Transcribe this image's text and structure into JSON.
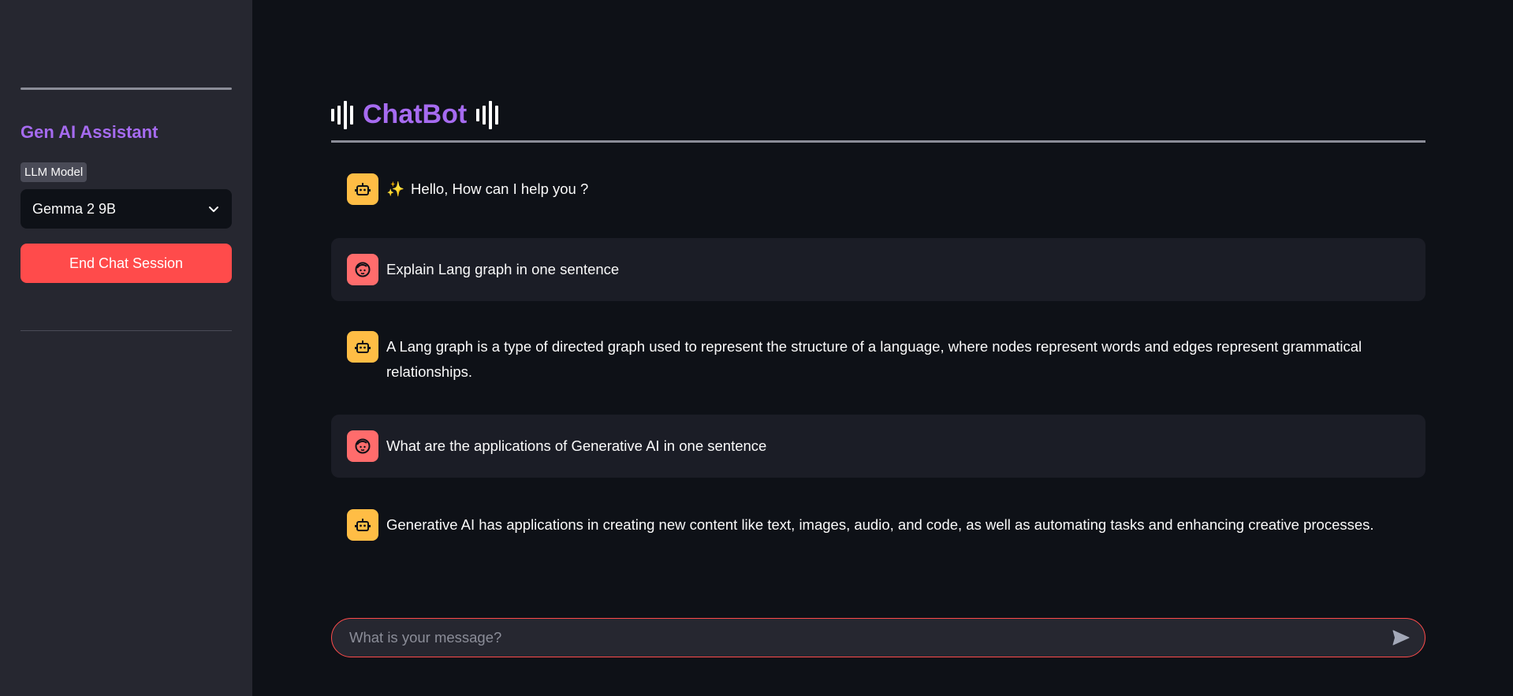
{
  "sidebar": {
    "title": "Gen AI Assistant",
    "model_label": "LLM Model",
    "model_selected": "Gemma 2 9B",
    "end_button": "End Chat Session"
  },
  "header": {
    "title": "ChatBot"
  },
  "messages": [
    {
      "role": "assistant",
      "icon": "robot-icon",
      "prefix": "✨",
      "text": "Hello, How can I help you ?"
    },
    {
      "role": "user",
      "icon": "user-face-icon",
      "text": "Explain Lang graph in one sentence"
    },
    {
      "role": "assistant",
      "icon": "robot-icon",
      "text": "A Lang graph is a type of directed graph used to represent the structure of a language, where nodes represent words and edges represent grammatical relationships."
    },
    {
      "role": "user",
      "icon": "user-face-icon",
      "text": "What are the applications of Generative AI in one sentence"
    },
    {
      "role": "assistant",
      "icon": "robot-icon",
      "text": "Generative AI has applications in creating new content like text, images, audio, and code, as well as automating tasks and enhancing creative processes."
    }
  ],
  "input": {
    "placeholder": "What is your message?"
  },
  "colors": {
    "accent": "#a66bf0",
    "button": "#ff4b4b",
    "bot_avatar": "#ffbd45",
    "user_avatar": "#ff6c6c"
  }
}
